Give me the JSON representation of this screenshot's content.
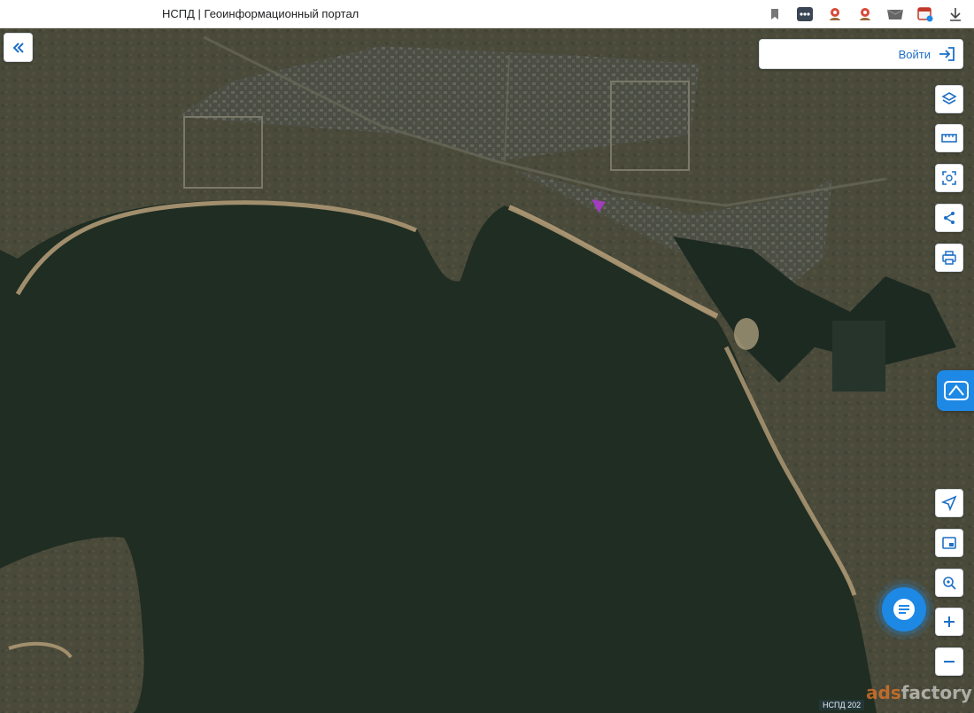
{
  "window": {
    "title": "НСПД | Геоинформационный портал"
  },
  "toolbar_icons": [
    "bookmark-icon",
    "more-icon",
    "extension-icon-1",
    "extension-icon-2",
    "mail-icon",
    "calendar-extension-icon",
    "download-icon"
  ],
  "header": {
    "login_label": "Войти"
  },
  "map_controls": {
    "top": [
      "layers-icon",
      "ruler-icon",
      "select-area-icon",
      "share-icon",
      "print-icon"
    ],
    "bottom": [
      "locate-icon",
      "minimap-icon",
      "search-location-icon",
      "zoom-in-icon",
      "zoom-out-icon"
    ]
  },
  "attribution": "НСПД 202",
  "watermark": {
    "ads": "ads",
    "rest": "factory"
  },
  "colors": {
    "accent": "#1e88e5",
    "water": "#1f2d22",
    "land": "#4a4a38",
    "beach": "#b8a07a"
  }
}
